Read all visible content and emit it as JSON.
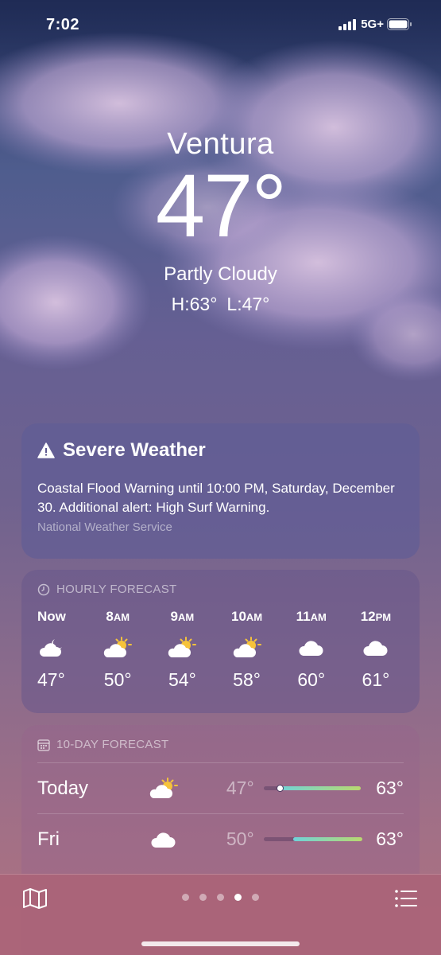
{
  "status": {
    "time": "7:02",
    "network": "5G+"
  },
  "location": {
    "city": "Ventura",
    "temperature": "47°",
    "condition": "Partly Cloudy",
    "high": "H:63°",
    "low": "L:47°"
  },
  "alert": {
    "title": "Severe Weather",
    "body": "Coastal Flood Warning until 10:00 PM, Saturday, December 30. Additional alert: High Surf Warning.",
    "source": "National Weather Service"
  },
  "hourly": {
    "header": "HOURLY FORECAST",
    "items": [
      {
        "time": "Now",
        "suffix": "",
        "icon": "cloud-moon-icon",
        "temp": "47°"
      },
      {
        "time": "8",
        "suffix": "AM",
        "icon": "cloud-sun-icon",
        "temp": "50°"
      },
      {
        "time": "9",
        "suffix": "AM",
        "icon": "cloud-sun-icon",
        "temp": "54°"
      },
      {
        "time": "10",
        "suffix": "AM",
        "icon": "cloud-sun-icon",
        "temp": "58°"
      },
      {
        "time": "11",
        "suffix": "AM",
        "icon": "cloud-icon",
        "temp": "60°"
      },
      {
        "time": "12",
        "suffix": "PM",
        "icon": "cloud-icon",
        "temp": "61°"
      }
    ]
  },
  "daily": {
    "header": "10-DAY FORECAST",
    "days": [
      {
        "name": "Today",
        "icon": "cloud-sun-icon",
        "low": "47°",
        "high": "63°",
        "current_temp_marker": true
      },
      {
        "name": "Fri",
        "icon": "cloud-icon",
        "low": "50°",
        "high": "63°"
      }
    ]
  },
  "pager": {
    "page_count": 5,
    "active_index": 3
  },
  "colors": {
    "bar_start": "#6fd3d9",
    "bar_end": "#b9d86f",
    "sun": "#f6c33a"
  }
}
